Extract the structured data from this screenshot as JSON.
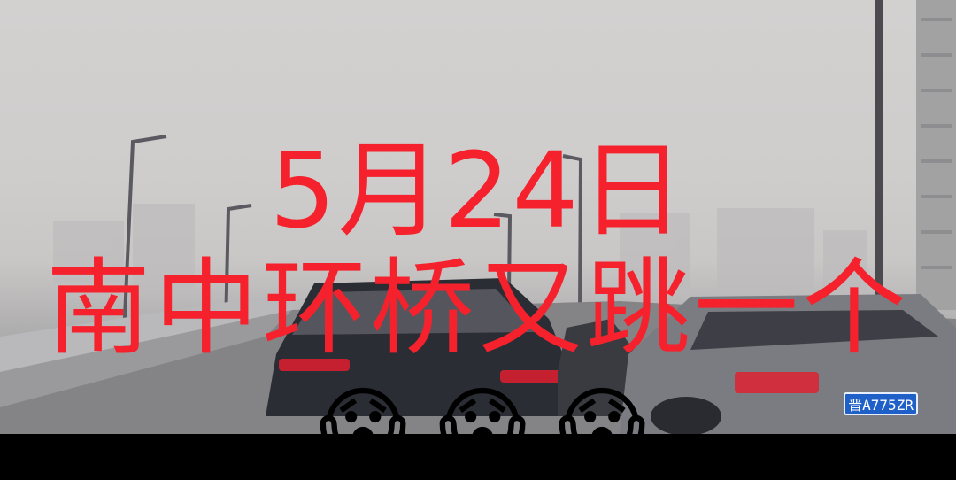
{
  "caption": {
    "line1": "5月24日",
    "line2": "南中环桥又跳一个"
  },
  "emojis": [
    "😱",
    "😱",
    "😱"
  ],
  "license_plate": "晋A775ZR",
  "colors": {
    "caption_text": "#f5222d",
    "sky": "#d1cfce",
    "road": "#8d8c8f",
    "letterbox": "#000000"
  }
}
